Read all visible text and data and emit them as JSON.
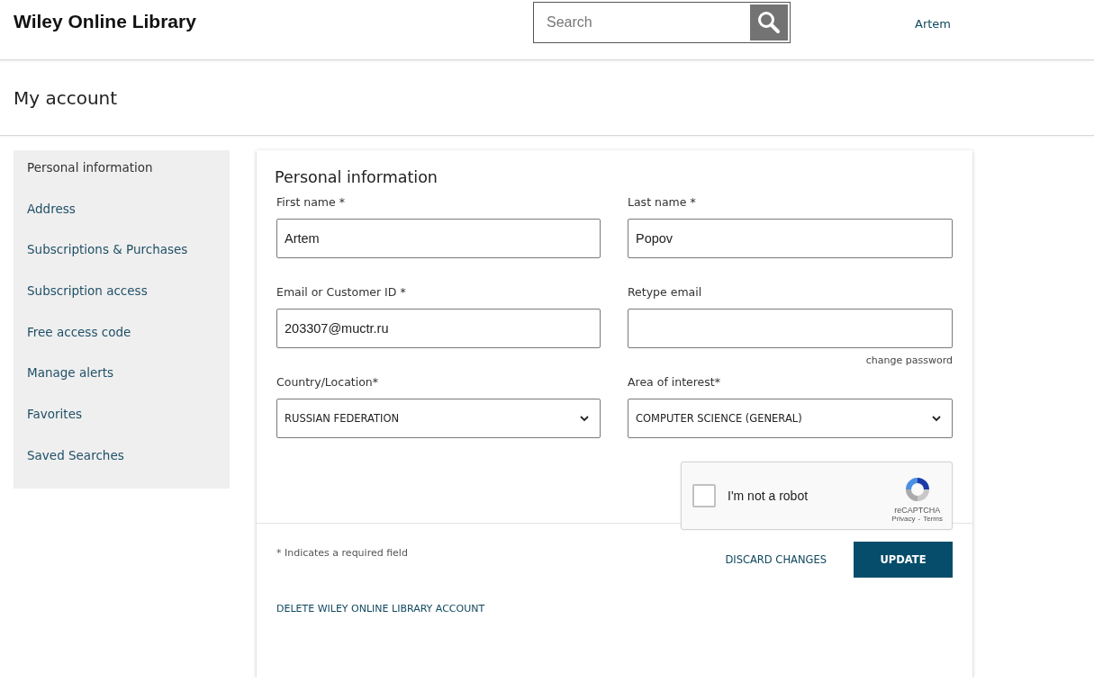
{
  "header": {
    "logo": "Wiley Online Library",
    "search": {
      "placeholder": "Search"
    },
    "user": "Artem"
  },
  "page_title": "My account",
  "sidebar": {
    "items": [
      {
        "label": "Personal information",
        "selected": true
      },
      {
        "label": "Address",
        "selected": false
      },
      {
        "label": "Subscriptions & Purchases",
        "selected": false
      },
      {
        "label": "Subscription access",
        "selected": false
      },
      {
        "label": "Free access code",
        "selected": false
      },
      {
        "label": "Manage alerts",
        "selected": false
      },
      {
        "label": "Favorites",
        "selected": false
      },
      {
        "label": "Saved Searches",
        "selected": false
      }
    ]
  },
  "form": {
    "title": "Personal information",
    "fields": [
      {
        "kind": "text",
        "label": "First name *",
        "value": "Artem"
      },
      {
        "kind": "text",
        "label": "Last name *",
        "value": "Popov"
      },
      {
        "kind": "text",
        "label": "Email or Customer ID *",
        "value": "203307@muctr.ru"
      },
      {
        "kind": "text",
        "label": "Retype email",
        "link": "change password"
      },
      {
        "kind": "select",
        "label": "Country/Location*",
        "value": "RUSSIAN FEDERATION"
      },
      {
        "kind": "select",
        "label": "Area of interest*",
        "value": "COMPUTER SCIENCE (GENERAL)"
      }
    ],
    "captcha": {
      "label": "I'm not a robot",
      "checked": false,
      "brand": "reCAPTCHA",
      "privacy": "Privacy",
      "separator": "-",
      "terms": "Terms"
    },
    "required_note": "* Indicates a required field",
    "discard_button": "DISCARD CHANGES",
    "update_button": "UPDATE",
    "delete_link": "DELETE WILEY ONLINE LIBRARY ACCOUNT"
  }
}
